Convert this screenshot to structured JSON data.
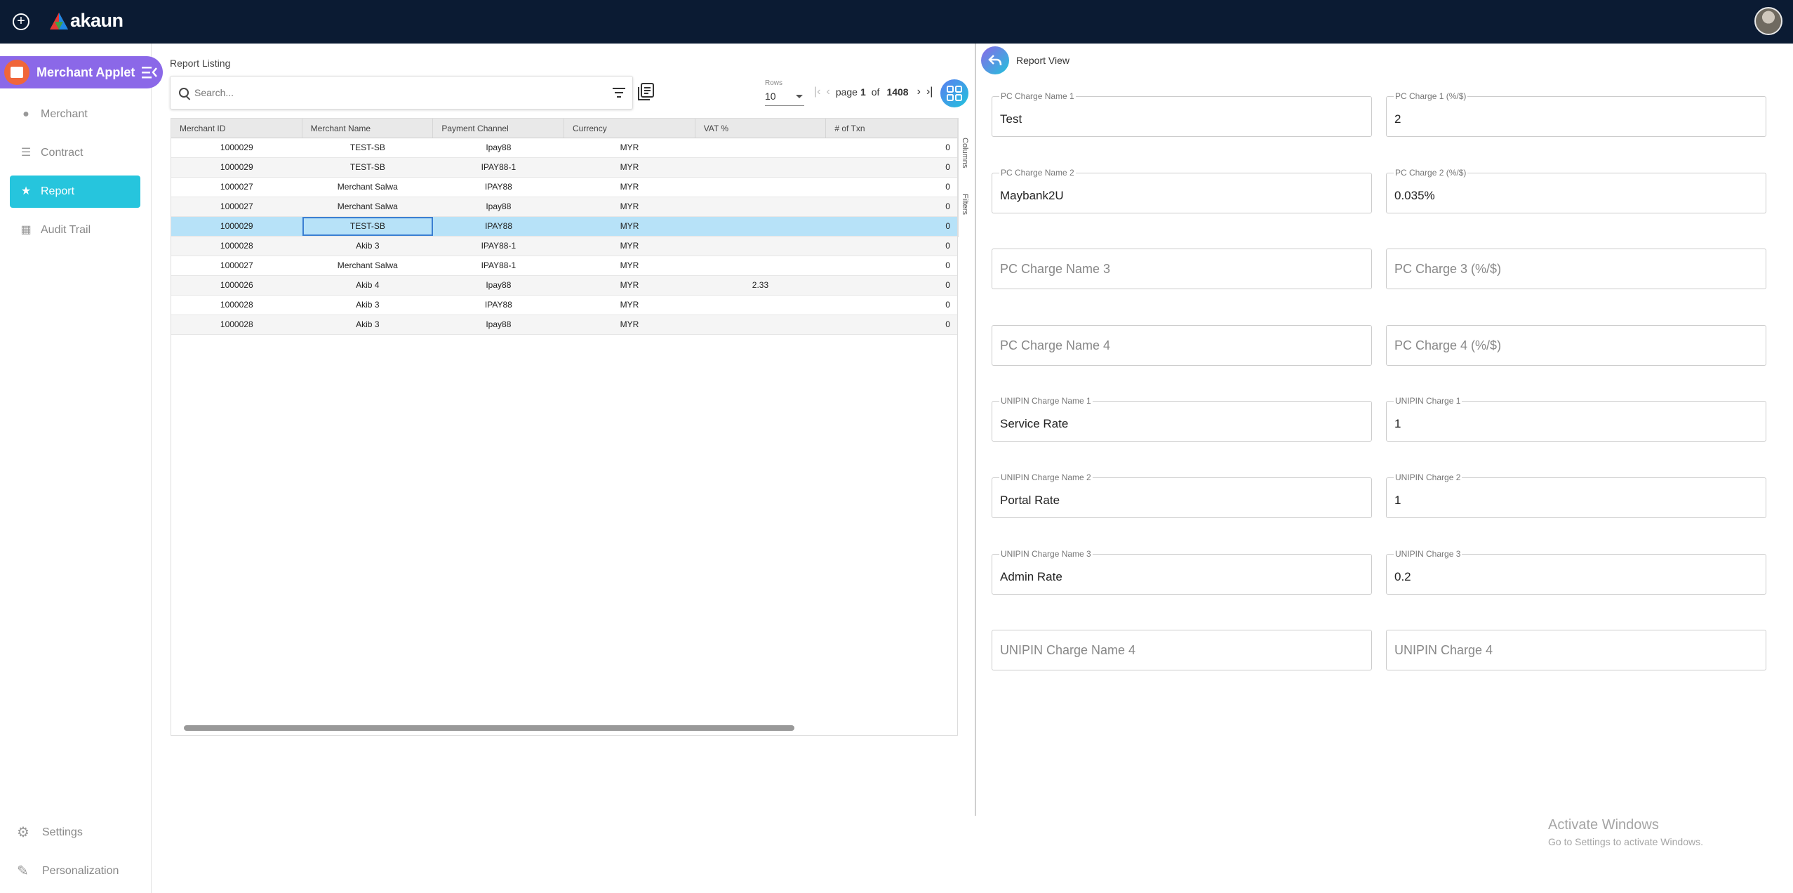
{
  "topbar": {
    "brand": "akaun"
  },
  "sidebar": {
    "applet_title": "Merchant Applet",
    "items": [
      {
        "label": "Merchant",
        "icon": "person-icon"
      },
      {
        "label": "Contract",
        "icon": "document-icon"
      },
      {
        "label": "Report",
        "icon": "star-icon"
      },
      {
        "label": "Audit Trail",
        "icon": "building-icon"
      }
    ],
    "settings": "Settings",
    "personalization": "Personalization"
  },
  "listing": {
    "title": "Report Listing",
    "search_placeholder": "Search...",
    "rows_label": "Rows",
    "rows_value": "10",
    "page_word": "page",
    "page_current": "1",
    "of_word": "of",
    "page_total": "1408",
    "columns": [
      "Merchant ID",
      "Merchant Name",
      "Payment Channel",
      "Currency",
      "VAT %",
      "# of Txn"
    ],
    "rows": [
      [
        "1000029",
        "TEST-SB",
        "Ipay88",
        "MYR",
        "",
        "0"
      ],
      [
        "1000029",
        "TEST-SB",
        "IPAY88-1",
        "MYR",
        "",
        "0"
      ],
      [
        "1000027",
        "Merchant Salwa",
        "IPAY88",
        "MYR",
        "",
        "0"
      ],
      [
        "1000027",
        "Merchant Salwa",
        "Ipay88",
        "MYR",
        "",
        "0"
      ],
      [
        "1000029",
        "TEST-SB",
        "IPAY88",
        "MYR",
        "",
        "0"
      ],
      [
        "1000028",
        "Akib 3",
        "IPAY88-1",
        "MYR",
        "",
        "0"
      ],
      [
        "1000027",
        "Merchant Salwa",
        "IPAY88-1",
        "MYR",
        "",
        "0"
      ],
      [
        "1000026",
        "Akib 4",
        "Ipay88",
        "MYR",
        "2.33",
        "0"
      ],
      [
        "1000028",
        "Akib 3",
        "IPAY88",
        "MYR",
        "",
        "0"
      ],
      [
        "1000028",
        "Akib 3",
        "Ipay88",
        "MYR",
        "",
        "0"
      ]
    ],
    "side_columns": "Columns",
    "side_filters": "Filters"
  },
  "report_view": {
    "title": "Report View",
    "fields": [
      {
        "label": "PC Charge Name 1",
        "value": "Test"
      },
      {
        "label": "PC Charge 1 (%/$)",
        "value": "2"
      },
      {
        "label": "PC Charge Name 2",
        "value": "Maybank2U"
      },
      {
        "label": "PC Charge 2 (%/$)",
        "value": "0.035%"
      },
      {
        "label": "",
        "value": "",
        "placeholder": "PC Charge Name 3"
      },
      {
        "label": "",
        "value": "",
        "placeholder": "PC Charge 3 (%/$)"
      },
      {
        "label": "",
        "value": "",
        "placeholder": "PC Charge Name 4"
      },
      {
        "label": "",
        "value": "",
        "placeholder": "PC Charge 4 (%/$)"
      },
      {
        "label": "UNIPIN Charge Name 1",
        "value": "Service Rate"
      },
      {
        "label": "UNIPIN Charge 1",
        "value": "1"
      },
      {
        "label": "UNIPIN Charge Name 2",
        "value": "Portal Rate"
      },
      {
        "label": "UNIPIN Charge 2",
        "value": "1"
      },
      {
        "label": "UNIPIN Charge Name 3",
        "value": "Admin Rate"
      },
      {
        "label": "UNIPIN Charge 3",
        "value": "0.2"
      },
      {
        "label": "",
        "value": "",
        "placeholder": "UNIPIN Charge Name 4"
      },
      {
        "label": "",
        "value": "",
        "placeholder": "UNIPIN Charge 4"
      }
    ]
  },
  "watermark": {
    "line1": "Activate Windows",
    "line2": "Go to Settings to activate Windows."
  },
  "colors": {
    "topbar": "#0b1b33",
    "applet": "#8b68e8",
    "active_nav": "#26c5dd",
    "selected_row": "#b7e2f8"
  }
}
